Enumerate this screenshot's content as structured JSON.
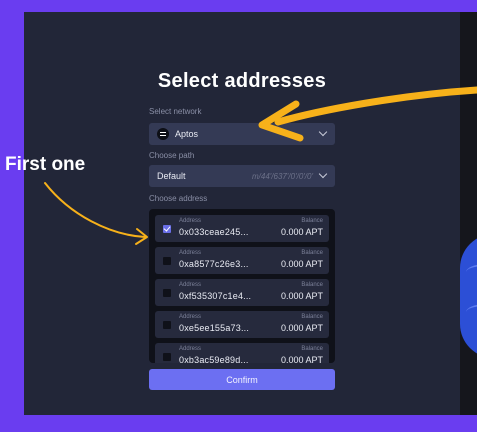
{
  "title": "Select addresses",
  "network": {
    "label": "Select network",
    "value": "Aptos",
    "icon": "aptos-icon"
  },
  "path": {
    "label": "Choose path",
    "value": "Default",
    "derivation": "m/44'/637'/0'/0'/0'"
  },
  "address_section": {
    "label": "Choose address",
    "address_label": "Address",
    "balance_label": "Balance",
    "rows": [
      {
        "address": "0x033ceae245...",
        "balance": "0.000 APT",
        "checked": true
      },
      {
        "address": "0xa8577c26e3...",
        "balance": "0.000 APT",
        "checked": false
      },
      {
        "address": "0xf535307c1e4...",
        "balance": "0.000 APT",
        "checked": false
      },
      {
        "address": "0xe5ee155a73...",
        "balance": "0.000 APT",
        "checked": false
      },
      {
        "address": "0xb3ac59e89d...",
        "balance": "0.000 APT",
        "checked": false
      }
    ]
  },
  "confirm_label": "Confirm",
  "annotation": {
    "text": "First one",
    "arrow_color": "#f7b11a"
  },
  "colors": {
    "frame": "#6a3df0",
    "panel": "#222638",
    "accent": "#6c6ff2"
  }
}
